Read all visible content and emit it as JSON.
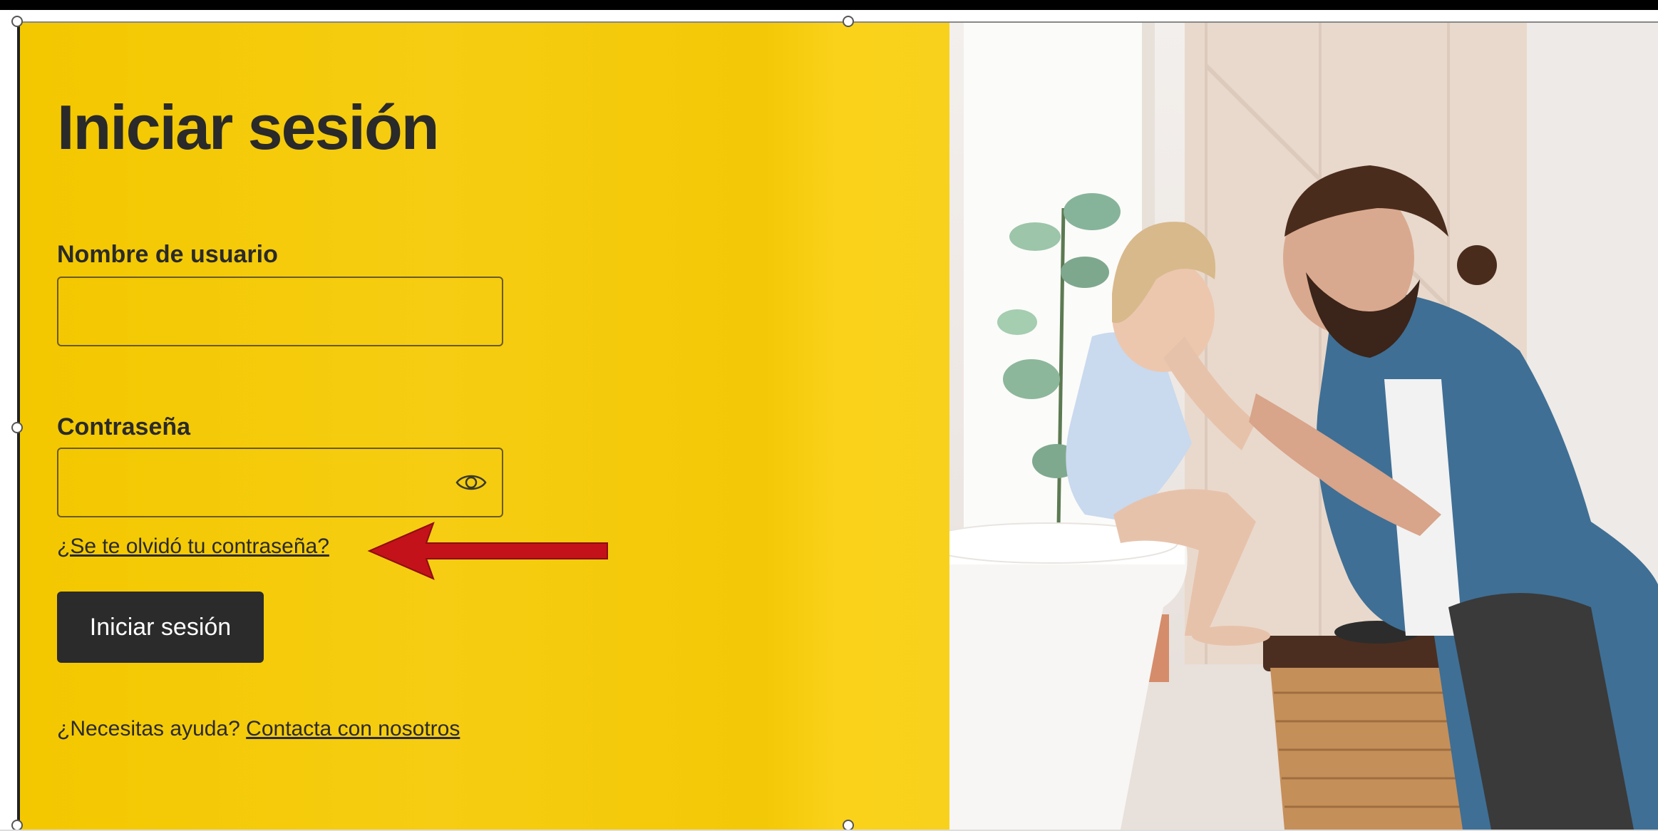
{
  "login": {
    "title": "Iniciar sesión",
    "username_label": "Nombre de usuario",
    "username_value": "",
    "password_label": "Contraseña",
    "password_value": "",
    "forgot_link": "¿Se te olvidó tu contraseña?",
    "submit_label": "Iniciar sesión",
    "help_text": "¿Necesitas ayuda?",
    "help_link": "Contacta con nosotros"
  },
  "icons": {
    "password_toggle": "eye-icon",
    "annotation": "red-arrow"
  },
  "colors": {
    "panel_background": "#f3c800",
    "button_background": "#2b2b2b",
    "button_text": "#ffffff",
    "text": "#2a2a2a",
    "annotation_arrow": "#c4121a"
  }
}
